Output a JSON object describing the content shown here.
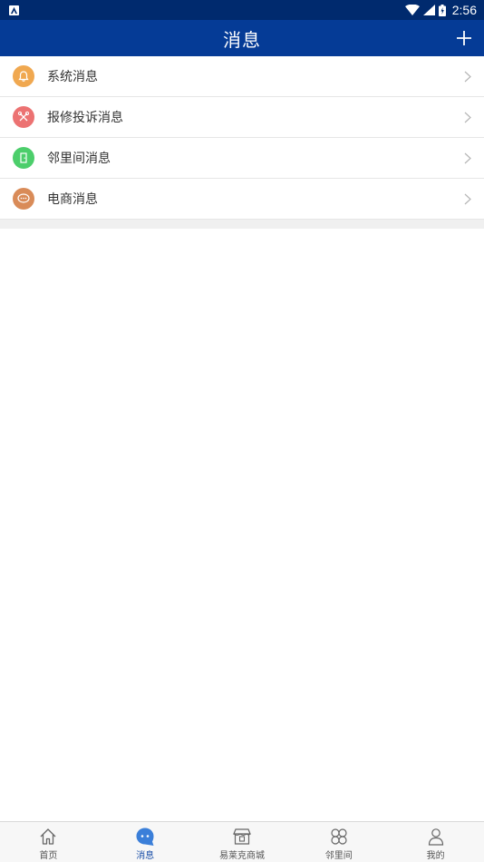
{
  "status_bar": {
    "time": "2:56",
    "app_glyph": "A"
  },
  "header": {
    "title": "消息",
    "add_icon": "plus-icon"
  },
  "message_types": [
    {
      "label": "系统消息",
      "icon": "bell-icon",
      "color": "#f0a850"
    },
    {
      "label": "报修投诉消息",
      "icon": "tools-icon",
      "color": "#ec7272"
    },
    {
      "label": "邻里间消息",
      "icon": "door-icon",
      "color": "#4cce6b"
    },
    {
      "label": "电商消息",
      "icon": "chat-bubble-icon",
      "color": "#d98b58"
    }
  ],
  "tabs": [
    {
      "label": "首页",
      "icon": "home-icon",
      "active": false
    },
    {
      "label": "消息",
      "icon": "message-icon",
      "active": true
    },
    {
      "label": "易莱克商城",
      "icon": "shop-icon",
      "active": false
    },
    {
      "label": "邻里间",
      "icon": "clover-icon",
      "active": false
    },
    {
      "label": "我的",
      "icon": "person-icon",
      "active": false
    }
  ],
  "colors": {
    "status_bar": "#002a6e",
    "nav_bar": "#053b96",
    "active_tab": "#1a4fa8"
  }
}
